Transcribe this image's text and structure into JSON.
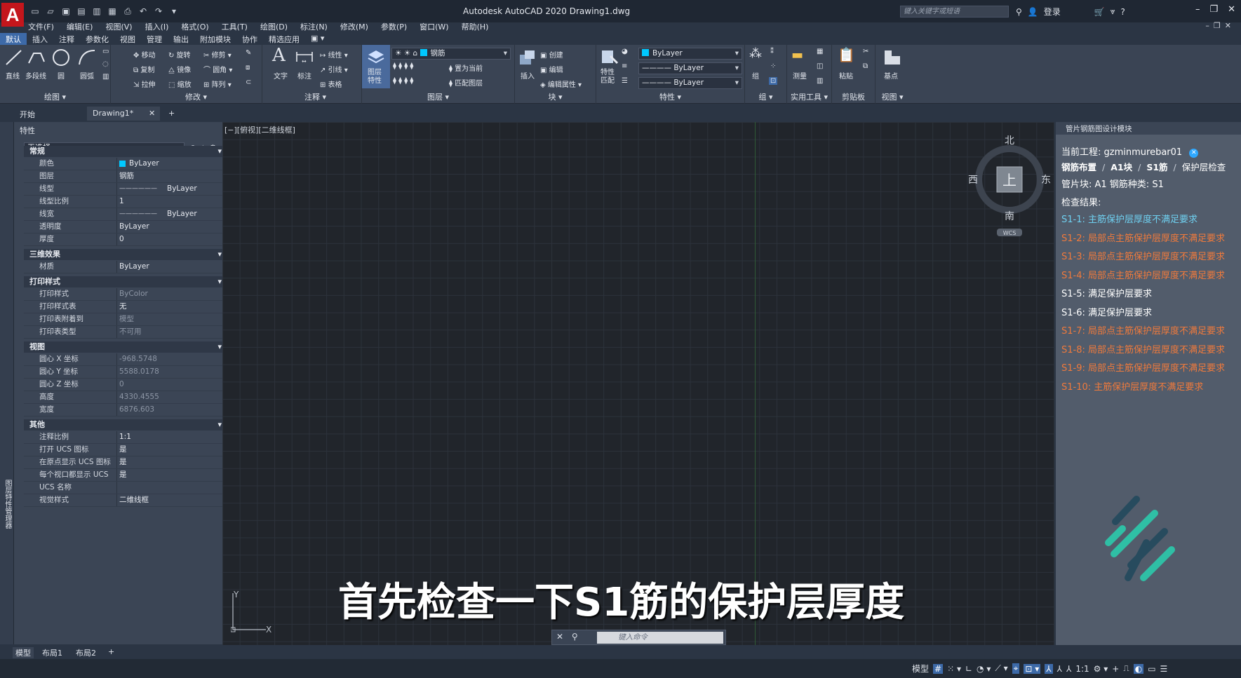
{
  "app": {
    "title": "Autodesk AutoCAD 2020    Drawing1.dwg",
    "logo": "A",
    "search_placeholder": "键入关键字或短语",
    "login": "登录",
    "menus": [
      "文件(F)",
      "编辑(E)",
      "视图(V)",
      "插入(I)",
      "格式(O)",
      "工具(T)",
      "绘图(D)",
      "标注(N)",
      "修改(M)",
      "参数(P)",
      "窗口(W)",
      "帮助(H)"
    ],
    "ribbon_tabs": [
      "默认",
      "插入",
      "注释",
      "参数化",
      "视图",
      "管理",
      "输出",
      "附加模块",
      "协作",
      "精选应用"
    ]
  },
  "ribbon": {
    "draw": {
      "line": "直线",
      "polyline": "多段线",
      "circle": "圆",
      "arc": "圆弧",
      "title": "绘图"
    },
    "modify": {
      "move": "移动",
      "rotate": "旋转",
      "trim": "修剪",
      "copy": "复制",
      "mirror": "镜像",
      "fillet": "圆角",
      "stretch": "拉伸",
      "scale": "缩放",
      "array": "阵列",
      "title": "修改"
    },
    "annotation": {
      "text": "文字",
      "dimension": "标注",
      "linear": "线性",
      "leader": "引线",
      "table": "表格",
      "title": "注释"
    },
    "layers": {
      "layer_props": "图层\n特性",
      "current_layer": "钢筋",
      "make_current": "置为当前",
      "match_layer": "匹配图层",
      "title": "图层"
    },
    "block": {
      "insert": "插入",
      "create": "创建",
      "edit": "编辑",
      "edit_attr": "编辑属性",
      "title": "块"
    },
    "properties": {
      "match": "特性\n匹配",
      "color": "ByLayer",
      "linetype": "ByLayer",
      "lineweight": "ByLayer",
      "title": "特性"
    },
    "groups": {
      "group": "组",
      "title": "组"
    },
    "utilities": {
      "measure": "测量",
      "title": "实用工具"
    },
    "clipboard": {
      "paste": "粘贴",
      "title": "剪贴板"
    },
    "view": {
      "base": "基点",
      "title": "视图"
    }
  },
  "doc_tabs": {
    "start": "开始",
    "drawing": "Drawing1*"
  },
  "properties_palette": {
    "header": "特性",
    "selection": "无选择",
    "side_label": "图层特性管理器",
    "sections": {
      "general": "常规",
      "3d": "三维效果",
      "plot": "打印样式",
      "view": "视图",
      "misc": "其他"
    },
    "general_rows": [
      {
        "k": "颜色",
        "v": "ByLayer"
      },
      {
        "k": "图层",
        "v": "钢筋"
      },
      {
        "k": "线型",
        "v": "ByLayer"
      },
      {
        "k": "线型比例",
        "v": "1"
      },
      {
        "k": "线宽",
        "v": "ByLayer"
      },
      {
        "k": "透明度",
        "v": "ByLayer"
      },
      {
        "k": "厚度",
        "v": "0"
      }
    ],
    "threed_rows": [
      {
        "k": "材质",
        "v": "ByLayer"
      }
    ],
    "plot_rows": [
      {
        "k": "打印样式",
        "v": "ByColor"
      },
      {
        "k": "打印样式表",
        "v": "无"
      },
      {
        "k": "打印表附着到",
        "v": "模型"
      },
      {
        "k": "打印表类型",
        "v": "不可用"
      }
    ],
    "view_rows": [
      {
        "k": "圆心 X 坐标",
        "v": "-968.5748"
      },
      {
        "k": "圆心 Y 坐标",
        "v": "5588.0178"
      },
      {
        "k": "圆心 Z 坐标",
        "v": "0"
      },
      {
        "k": "高度",
        "v": "4330.4555"
      },
      {
        "k": "宽度",
        "v": "6876.603"
      }
    ],
    "misc_rows": [
      {
        "k": "注释比例",
        "v": "1:1"
      },
      {
        "k": "打开 UCS 图标",
        "v": "是"
      },
      {
        "k": "在原点显示 UCS 图标",
        "v": "是"
      },
      {
        "k": "每个视口都显示 UCS",
        "v": "是"
      },
      {
        "k": "UCS 名称",
        "v": ""
      },
      {
        "k": "视觉样式",
        "v": "二维线框"
      }
    ]
  },
  "viewport": {
    "label": "[−][俯视][二维线框]",
    "viewcube": {
      "n": "北",
      "s": "南",
      "e": "东",
      "w": "西",
      "face": "上",
      "wcs": "WCS"
    },
    "ucs": {
      "x": "X",
      "y": "Y"
    },
    "subtitle": "首先检查一下S1筋的保护层厚度",
    "command_placeholder": "键入命令"
  },
  "rebar_panel": {
    "header": "管片钢筋图设计模块",
    "project_label": "当前工程:",
    "project_name": "gzminmurebar01",
    "breadcrumb": [
      "钢筋布置",
      "A1块",
      "S1筋",
      "保护层检查"
    ],
    "block_info": "管片块: A1 钢筋种类: S1",
    "result_label": "检查结果:",
    "results": [
      {
        "text": "S1-1: 主筋保护层厚度不满足要求",
        "status": "sel"
      },
      {
        "text": "S1-2: 局部点主筋保护层厚度不满足要求",
        "status": "bad"
      },
      {
        "text": "S1-3: 局部点主筋保护层厚度不满足要求",
        "status": "bad"
      },
      {
        "text": "S1-4: 局部点主筋保护层厚度不满足要求",
        "status": "bad"
      },
      {
        "text": "S1-5: 满足保护层要求",
        "status": "ok"
      },
      {
        "text": "S1-6: 满足保护层要求",
        "status": "ok"
      },
      {
        "text": "S1-7: 局部点主筋保护层厚度不满足要求",
        "status": "bad"
      },
      {
        "text": "S1-8: 局部点主筋保护层厚度不满足要求",
        "status": "bad"
      },
      {
        "text": "S1-9: 局部点主筋保护层厚度不满足要求",
        "status": "bad"
      },
      {
        "text": "S1-10: 主筋保护层厚度不满足要求",
        "status": "bad"
      }
    ]
  },
  "layout_tabs": [
    "模型",
    "布局1",
    "布局2"
  ],
  "status": {
    "model": "模型",
    "scale": "1:1"
  },
  "colors": {
    "accent": "#3d6aa8",
    "ok": "#ffffff",
    "bad": "#f07a3c",
    "selected": "#6fd0f0",
    "layer_color": "#00c8ff"
  }
}
